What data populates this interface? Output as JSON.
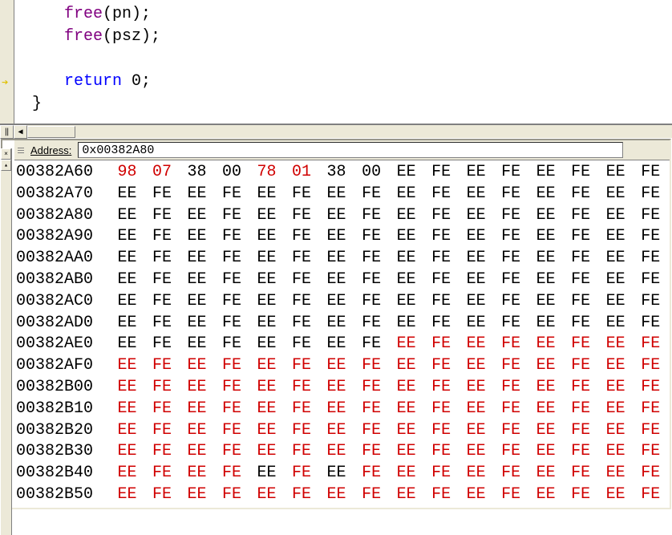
{
  "code": {
    "lines": [
      {
        "free": "free",
        "arg": "pn"
      },
      {
        "free": "free",
        "arg": "psz"
      }
    ],
    "return_kw": "return",
    "return_val": "0",
    "brace": "}"
  },
  "memory": {
    "address_label": "Address:",
    "address_value": "0x00382A80",
    "rows": [
      {
        "addr": "00382A60",
        "cells": [
          {
            "v": "98",
            "hl": true
          },
          {
            "v": "07",
            "hl": true
          },
          {
            "v": "38",
            "hl": false
          },
          {
            "v": "00",
            "hl": false
          },
          {
            "v": "78",
            "hl": true
          },
          {
            "v": "01",
            "hl": true
          },
          {
            "v": "38",
            "hl": false
          },
          {
            "v": "00",
            "hl": false
          },
          {
            "v": "EE",
            "hl": false
          },
          {
            "v": "FE",
            "hl": false
          },
          {
            "v": "EE",
            "hl": false
          },
          {
            "v": "FE",
            "hl": false
          },
          {
            "v": "EE",
            "hl": false
          },
          {
            "v": "FE",
            "hl": false
          },
          {
            "v": "EE",
            "hl": false
          },
          {
            "v": "FE",
            "hl": false
          }
        ]
      },
      {
        "addr": "00382A70",
        "cells": [
          {
            "v": "EE",
            "hl": false
          },
          {
            "v": "FE",
            "hl": false
          },
          {
            "v": "EE",
            "hl": false
          },
          {
            "v": "FE",
            "hl": false
          },
          {
            "v": "EE",
            "hl": false
          },
          {
            "v": "FE",
            "hl": false
          },
          {
            "v": "EE",
            "hl": false
          },
          {
            "v": "FE",
            "hl": false
          },
          {
            "v": "EE",
            "hl": false
          },
          {
            "v": "FE",
            "hl": false
          },
          {
            "v": "EE",
            "hl": false
          },
          {
            "v": "FE",
            "hl": false
          },
          {
            "v": "EE",
            "hl": false
          },
          {
            "v": "FE",
            "hl": false
          },
          {
            "v": "EE",
            "hl": false
          },
          {
            "v": "FE",
            "hl": false
          }
        ]
      },
      {
        "addr": "00382A80",
        "cells": [
          {
            "v": "EE",
            "hl": false
          },
          {
            "v": "FE",
            "hl": false
          },
          {
            "v": "EE",
            "hl": false
          },
          {
            "v": "FE",
            "hl": false
          },
          {
            "v": "EE",
            "hl": false
          },
          {
            "v": "FE",
            "hl": false
          },
          {
            "v": "EE",
            "hl": false
          },
          {
            "v": "FE",
            "hl": false
          },
          {
            "v": "EE",
            "hl": false
          },
          {
            "v": "FE",
            "hl": false
          },
          {
            "v": "EE",
            "hl": false
          },
          {
            "v": "FE",
            "hl": false
          },
          {
            "v": "EE",
            "hl": false
          },
          {
            "v": "FE",
            "hl": false
          },
          {
            "v": "EE",
            "hl": false
          },
          {
            "v": "FE",
            "hl": false
          }
        ]
      },
      {
        "addr": "00382A90",
        "cells": [
          {
            "v": "EE",
            "hl": false
          },
          {
            "v": "FE",
            "hl": false
          },
          {
            "v": "EE",
            "hl": false
          },
          {
            "v": "FE",
            "hl": false
          },
          {
            "v": "EE",
            "hl": false
          },
          {
            "v": "FE",
            "hl": false
          },
          {
            "v": "EE",
            "hl": false
          },
          {
            "v": "FE",
            "hl": false
          },
          {
            "v": "EE",
            "hl": false
          },
          {
            "v": "FE",
            "hl": false
          },
          {
            "v": "EE",
            "hl": false
          },
          {
            "v": "FE",
            "hl": false
          },
          {
            "v": "EE",
            "hl": false
          },
          {
            "v": "FE",
            "hl": false
          },
          {
            "v": "EE",
            "hl": false
          },
          {
            "v": "FE",
            "hl": false
          }
        ]
      },
      {
        "addr": "00382AA0",
        "cells": [
          {
            "v": "EE",
            "hl": false
          },
          {
            "v": "FE",
            "hl": false
          },
          {
            "v": "EE",
            "hl": false
          },
          {
            "v": "FE",
            "hl": false
          },
          {
            "v": "EE",
            "hl": false
          },
          {
            "v": "FE",
            "hl": false
          },
          {
            "v": "EE",
            "hl": false
          },
          {
            "v": "FE",
            "hl": false
          },
          {
            "v": "EE",
            "hl": false
          },
          {
            "v": "FE",
            "hl": false
          },
          {
            "v": "EE",
            "hl": false
          },
          {
            "v": "FE",
            "hl": false
          },
          {
            "v": "EE",
            "hl": false
          },
          {
            "v": "FE",
            "hl": false
          },
          {
            "v": "EE",
            "hl": false
          },
          {
            "v": "FE",
            "hl": false
          }
        ]
      },
      {
        "addr": "00382AB0",
        "cells": [
          {
            "v": "EE",
            "hl": false
          },
          {
            "v": "FE",
            "hl": false
          },
          {
            "v": "EE",
            "hl": false
          },
          {
            "v": "FE",
            "hl": false
          },
          {
            "v": "EE",
            "hl": false
          },
          {
            "v": "FE",
            "hl": false
          },
          {
            "v": "EE",
            "hl": false
          },
          {
            "v": "FE",
            "hl": false
          },
          {
            "v": "EE",
            "hl": false
          },
          {
            "v": "FE",
            "hl": false
          },
          {
            "v": "EE",
            "hl": false
          },
          {
            "v": "FE",
            "hl": false
          },
          {
            "v": "EE",
            "hl": false
          },
          {
            "v": "FE",
            "hl": false
          },
          {
            "v": "EE",
            "hl": false
          },
          {
            "v": "FE",
            "hl": false
          }
        ]
      },
      {
        "addr": "00382AC0",
        "cells": [
          {
            "v": "EE",
            "hl": false
          },
          {
            "v": "FE",
            "hl": false
          },
          {
            "v": "EE",
            "hl": false
          },
          {
            "v": "FE",
            "hl": false
          },
          {
            "v": "EE",
            "hl": false
          },
          {
            "v": "FE",
            "hl": false
          },
          {
            "v": "EE",
            "hl": false
          },
          {
            "v": "FE",
            "hl": false
          },
          {
            "v": "EE",
            "hl": false
          },
          {
            "v": "FE",
            "hl": false
          },
          {
            "v": "EE",
            "hl": false
          },
          {
            "v": "FE",
            "hl": false
          },
          {
            "v": "EE",
            "hl": false
          },
          {
            "v": "FE",
            "hl": false
          },
          {
            "v": "EE",
            "hl": false
          },
          {
            "v": "FE",
            "hl": false
          }
        ]
      },
      {
        "addr": "00382AD0",
        "cells": [
          {
            "v": "EE",
            "hl": false
          },
          {
            "v": "FE",
            "hl": false
          },
          {
            "v": "EE",
            "hl": false
          },
          {
            "v": "FE",
            "hl": false
          },
          {
            "v": "EE",
            "hl": false
          },
          {
            "v": "FE",
            "hl": false
          },
          {
            "v": "EE",
            "hl": false
          },
          {
            "v": "FE",
            "hl": false
          },
          {
            "v": "EE",
            "hl": false
          },
          {
            "v": "FE",
            "hl": false
          },
          {
            "v": "EE",
            "hl": false
          },
          {
            "v": "FE",
            "hl": false
          },
          {
            "v": "EE",
            "hl": false
          },
          {
            "v": "FE",
            "hl": false
          },
          {
            "v": "EE",
            "hl": false
          },
          {
            "v": "FE",
            "hl": false
          }
        ]
      },
      {
        "addr": "00382AE0",
        "cells": [
          {
            "v": "EE",
            "hl": false
          },
          {
            "v": "FE",
            "hl": false
          },
          {
            "v": "EE",
            "hl": false
          },
          {
            "v": "FE",
            "hl": false
          },
          {
            "v": "EE",
            "hl": false
          },
          {
            "v": "FE",
            "hl": false
          },
          {
            "v": "EE",
            "hl": false
          },
          {
            "v": "FE",
            "hl": false
          },
          {
            "v": "EE",
            "hl": true
          },
          {
            "v": "FE",
            "hl": true
          },
          {
            "v": "EE",
            "hl": true
          },
          {
            "v": "FE",
            "hl": true
          },
          {
            "v": "EE",
            "hl": true
          },
          {
            "v": "FE",
            "hl": true
          },
          {
            "v": "EE",
            "hl": true
          },
          {
            "v": "FE",
            "hl": true
          }
        ]
      },
      {
        "addr": "00382AF0",
        "cells": [
          {
            "v": "EE",
            "hl": true
          },
          {
            "v": "FE",
            "hl": true
          },
          {
            "v": "EE",
            "hl": true
          },
          {
            "v": "FE",
            "hl": true
          },
          {
            "v": "EE",
            "hl": true
          },
          {
            "v": "FE",
            "hl": true
          },
          {
            "v": "EE",
            "hl": true
          },
          {
            "v": "FE",
            "hl": true
          },
          {
            "v": "EE",
            "hl": true
          },
          {
            "v": "FE",
            "hl": true
          },
          {
            "v": "EE",
            "hl": true
          },
          {
            "v": "FE",
            "hl": true
          },
          {
            "v": "EE",
            "hl": true
          },
          {
            "v": "FE",
            "hl": true
          },
          {
            "v": "EE",
            "hl": true
          },
          {
            "v": "FE",
            "hl": true
          }
        ]
      },
      {
        "addr": "00382B00",
        "cells": [
          {
            "v": "EE",
            "hl": true
          },
          {
            "v": "FE",
            "hl": true
          },
          {
            "v": "EE",
            "hl": true
          },
          {
            "v": "FE",
            "hl": true
          },
          {
            "v": "EE",
            "hl": true
          },
          {
            "v": "FE",
            "hl": true
          },
          {
            "v": "EE",
            "hl": true
          },
          {
            "v": "FE",
            "hl": true
          },
          {
            "v": "EE",
            "hl": true
          },
          {
            "v": "FE",
            "hl": true
          },
          {
            "v": "EE",
            "hl": true
          },
          {
            "v": "FE",
            "hl": true
          },
          {
            "v": "EE",
            "hl": true
          },
          {
            "v": "FE",
            "hl": true
          },
          {
            "v": "EE",
            "hl": true
          },
          {
            "v": "FE",
            "hl": true
          }
        ]
      },
      {
        "addr": "00382B10",
        "cells": [
          {
            "v": "EE",
            "hl": true
          },
          {
            "v": "FE",
            "hl": true
          },
          {
            "v": "EE",
            "hl": true
          },
          {
            "v": "FE",
            "hl": true
          },
          {
            "v": "EE",
            "hl": true
          },
          {
            "v": "FE",
            "hl": true
          },
          {
            "v": "EE",
            "hl": true
          },
          {
            "v": "FE",
            "hl": true
          },
          {
            "v": "EE",
            "hl": true
          },
          {
            "v": "FE",
            "hl": true
          },
          {
            "v": "EE",
            "hl": true
          },
          {
            "v": "FE",
            "hl": true
          },
          {
            "v": "EE",
            "hl": true
          },
          {
            "v": "FE",
            "hl": true
          },
          {
            "v": "EE",
            "hl": true
          },
          {
            "v": "FE",
            "hl": true
          }
        ]
      },
      {
        "addr": "00382B20",
        "cells": [
          {
            "v": "EE",
            "hl": true
          },
          {
            "v": "FE",
            "hl": true
          },
          {
            "v": "EE",
            "hl": true
          },
          {
            "v": "FE",
            "hl": true
          },
          {
            "v": "EE",
            "hl": true
          },
          {
            "v": "FE",
            "hl": true
          },
          {
            "v": "EE",
            "hl": true
          },
          {
            "v": "FE",
            "hl": true
          },
          {
            "v": "EE",
            "hl": true
          },
          {
            "v": "FE",
            "hl": true
          },
          {
            "v": "EE",
            "hl": true
          },
          {
            "v": "FE",
            "hl": true
          },
          {
            "v": "EE",
            "hl": true
          },
          {
            "v": "FE",
            "hl": true
          },
          {
            "v": "EE",
            "hl": true
          },
          {
            "v": "FE",
            "hl": true
          }
        ]
      },
      {
        "addr": "00382B30",
        "cells": [
          {
            "v": "EE",
            "hl": true
          },
          {
            "v": "FE",
            "hl": true
          },
          {
            "v": "EE",
            "hl": true
          },
          {
            "v": "FE",
            "hl": true
          },
          {
            "v": "EE",
            "hl": true
          },
          {
            "v": "FE",
            "hl": true
          },
          {
            "v": "EE",
            "hl": true
          },
          {
            "v": "FE",
            "hl": true
          },
          {
            "v": "EE",
            "hl": true
          },
          {
            "v": "FE",
            "hl": true
          },
          {
            "v": "EE",
            "hl": true
          },
          {
            "v": "FE",
            "hl": true
          },
          {
            "v": "EE",
            "hl": true
          },
          {
            "v": "FE",
            "hl": true
          },
          {
            "v": "EE",
            "hl": true
          },
          {
            "v": "FE",
            "hl": true
          }
        ]
      },
      {
        "addr": "00382B40",
        "cells": [
          {
            "v": "EE",
            "hl": true
          },
          {
            "v": "FE",
            "hl": true
          },
          {
            "v": "EE",
            "hl": true
          },
          {
            "v": "FE",
            "hl": true
          },
          {
            "v": "EE",
            "hl": false
          },
          {
            "v": "FE",
            "hl": true
          },
          {
            "v": "EE",
            "hl": false
          },
          {
            "v": "FE",
            "hl": true
          },
          {
            "v": "EE",
            "hl": true
          },
          {
            "v": "FE",
            "hl": true
          },
          {
            "v": "EE",
            "hl": true
          },
          {
            "v": "FE",
            "hl": true
          },
          {
            "v": "EE",
            "hl": true
          },
          {
            "v": "FE",
            "hl": true
          },
          {
            "v": "EE",
            "hl": true
          },
          {
            "v": "FE",
            "hl": true
          }
        ]
      },
      {
        "addr": "00382B50",
        "cells": [
          {
            "v": "EE",
            "hl": true
          },
          {
            "v": "FE",
            "hl": true
          },
          {
            "v": "EE",
            "hl": true
          },
          {
            "v": "FE",
            "hl": true
          },
          {
            "v": "EE",
            "hl": true
          },
          {
            "v": "FE",
            "hl": true
          },
          {
            "v": "EE",
            "hl": true
          },
          {
            "v": "FE",
            "hl": true
          },
          {
            "v": "EE",
            "hl": true
          },
          {
            "v": "FE",
            "hl": true
          },
          {
            "v": "EE",
            "hl": true
          },
          {
            "v": "FE",
            "hl": true
          },
          {
            "v": "EE",
            "hl": true
          },
          {
            "v": "FE",
            "hl": true
          },
          {
            "v": "EE",
            "hl": true
          },
          {
            "v": "FE",
            "hl": true
          }
        ]
      }
    ]
  }
}
